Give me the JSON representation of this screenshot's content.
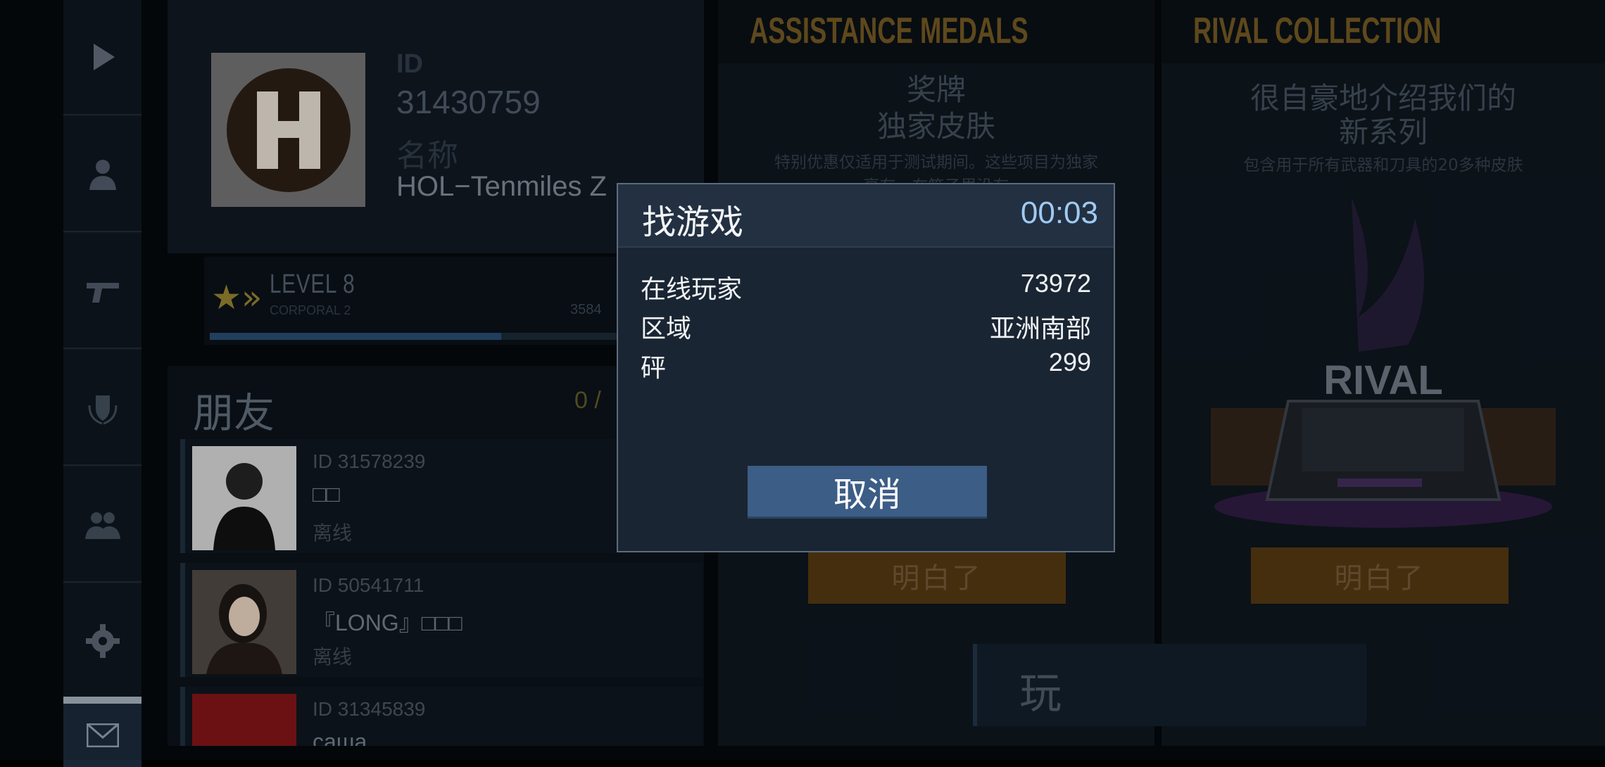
{
  "sidebar": {
    "items": [
      {
        "icon": "play-icon"
      },
      {
        "icon": "person-icon"
      },
      {
        "icon": "pistol-icon"
      },
      {
        "icon": "shield-laurel-icon"
      },
      {
        "icon": "friends-icon"
      },
      {
        "icon": "gear-icon"
      },
      {
        "icon": "mail-icon"
      }
    ]
  },
  "profile": {
    "id_label": "ID",
    "id_value": "31430759",
    "name_label": "名称",
    "name_value": "HOL−Tenmiles Z"
  },
  "level": {
    "title": "LEVEL 8",
    "rank": "CORPORAL 2",
    "xp": "3584",
    "progress": 0.6
  },
  "friends": {
    "title": "朋友",
    "count": "0 /",
    "items": [
      {
        "id": "ID 31578239",
        "name": "□□",
        "status": "离线"
      },
      {
        "id": "ID 50541711",
        "name": "『LONG』□□□",
        "status": "离线"
      },
      {
        "id": "ID 31345839",
        "name": "саша",
        "status": ""
      }
    ]
  },
  "medals": {
    "header": "ASSISTANCE MEDALS",
    "line1": "奖牌",
    "line2": "独家皮肤",
    "desc1": "特别优惠仅适用于测试期间。这些项目为独家",
    "desc2": "享有，在箱子里没有",
    "button": "明白了"
  },
  "rival": {
    "header": "RIVAL COLLECTION",
    "line1": "很自豪地介绍我们的",
    "line2": "新系列",
    "desc": "包含用于所有武器和刀具的20多种皮肤",
    "art_text": "RIVAL",
    "button": "明白了"
  },
  "play": {
    "label": "玩"
  },
  "modal": {
    "title": "找游戏",
    "timer": "00:03",
    "rows": [
      {
        "key": "在线玩家",
        "value": "73972"
      },
      {
        "key": "区域",
        "value": "亚洲南部"
      },
      {
        "key": "砰",
        "value": "299"
      }
    ],
    "cancel": "取消"
  },
  "colors": {
    "accent_gold": "#6b5320",
    "button_blue": "#3c5d85",
    "timer_blue": "#9fcaf2"
  }
}
